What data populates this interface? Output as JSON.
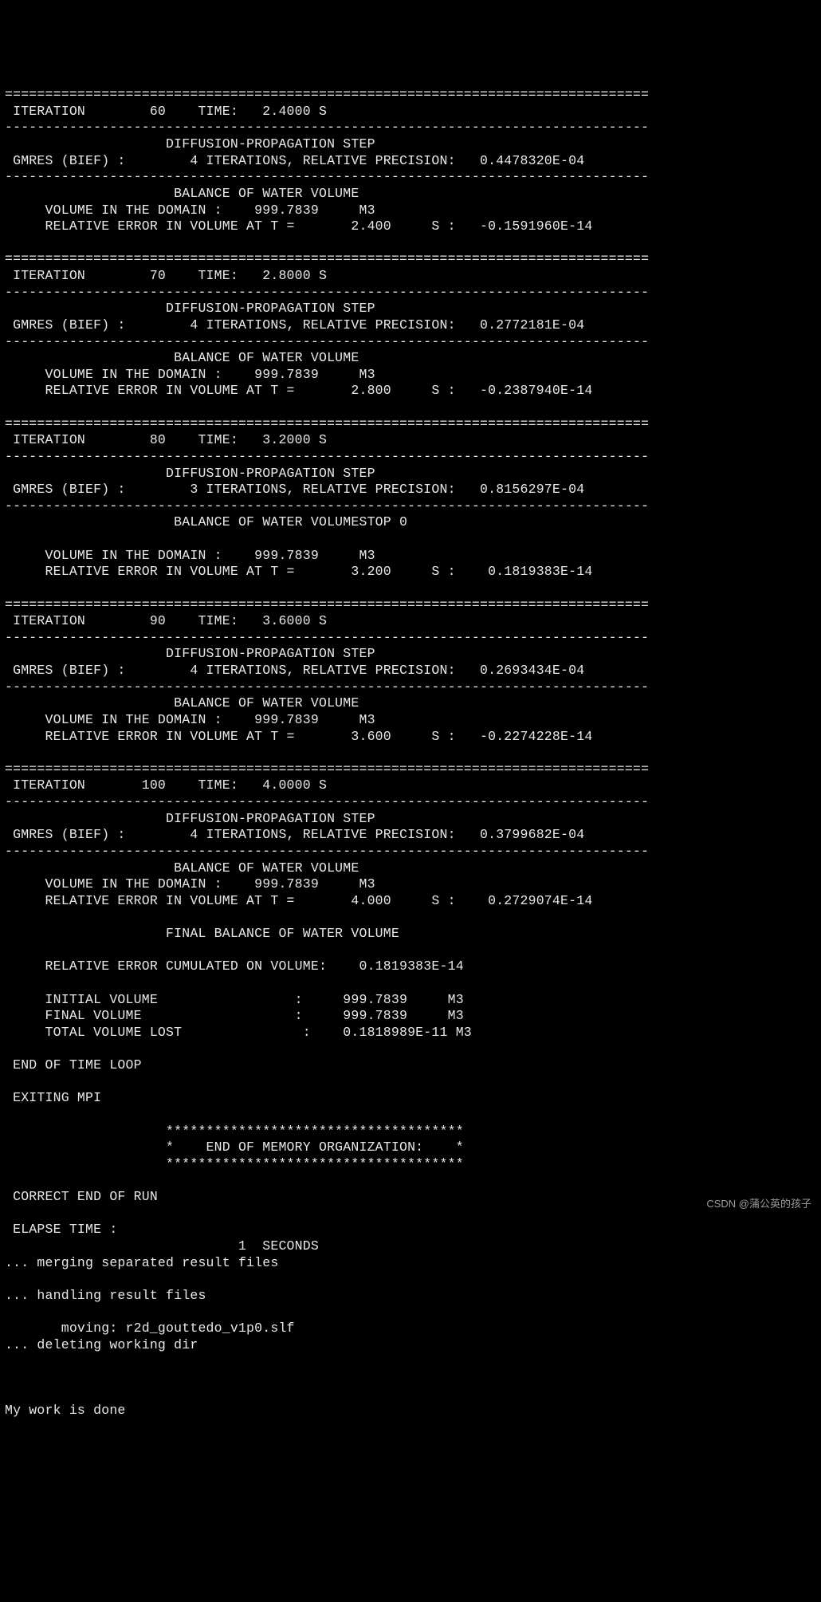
{
  "iterations": [
    {
      "iter": "60",
      "time": "2.4000",
      "gmres_iters": "4",
      "gmres_prec": "0.4478320E-04",
      "volume": "999.7839",
      "time_at": "2.400",
      "rel_err": "-0.1591960E-14",
      "stop_tag": ""
    },
    {
      "iter": "70",
      "time": "2.8000",
      "gmres_iters": "4",
      "gmres_prec": "0.2772181E-04",
      "volume": "999.7839",
      "time_at": "2.800",
      "rel_err": "-0.2387940E-14",
      "stop_tag": ""
    },
    {
      "iter": "80",
      "time": "3.2000",
      "gmres_iters": "3",
      "gmres_prec": "0.8156297E-04",
      "volume": "999.7839",
      "time_at": "3.200",
      "rel_err": " 0.1819383E-14",
      "stop_tag": "STOP 0",
      "extra_blank": true
    },
    {
      "iter": "90",
      "time": "3.6000",
      "gmres_iters": "4",
      "gmres_prec": "0.2693434E-04",
      "volume": "999.7839",
      "time_at": "3.600",
      "rel_err": "-0.2274228E-14",
      "stop_tag": ""
    },
    {
      "iter": "100",
      "time": "4.0000",
      "gmres_iters": "4",
      "gmres_prec": "0.3799682E-04",
      "volume": "999.7839",
      "time_at": "4.000",
      "rel_err": " 0.2729074E-14",
      "stop_tag": ""
    }
  ],
  "final": {
    "header": "FINAL BALANCE OF WATER VOLUME",
    "rel_err_cum": "0.1819383E-14",
    "initial_volume": "999.7839",
    "final_volume": "999.7839",
    "total_lost": "0.1818989E-11",
    "units": "M3"
  },
  "footer": {
    "end_loop": "END OF TIME LOOP",
    "exit_mpi": "EXITING MPI",
    "mem_org": "END OF MEMORY ORGANIZATION:",
    "correct_end": "CORRECT END OF RUN",
    "elapse_label": "ELAPSE TIME :",
    "elapse_value": "1",
    "elapse_units": "SECONDS",
    "merging": "... merging separated result files",
    "handling": "... handling result files",
    "moving": "moving: r2d_gouttedo_v1p0.slf",
    "deleting": "... deleting working dir",
    "done": "My work is done"
  },
  "labels": {
    "iteration": "ITERATION",
    "time": "TIME:",
    "s": "S",
    "diff_prop": "DIFFUSION-PROPAGATION STEP",
    "gmres": "GMRES (BIEF) :",
    "iters_rel": "ITERATIONS, RELATIVE PRECISION:",
    "balance": "BALANCE OF WATER VOLUME",
    "vol_domain": "VOLUME IN THE DOMAIN :",
    "m3": "M3",
    "rel_err_at": "RELATIVE ERROR IN VOLUME AT T =",
    "s_colon": "S :"
  },
  "watermark": "CSDN @蒲公英的孩子"
}
